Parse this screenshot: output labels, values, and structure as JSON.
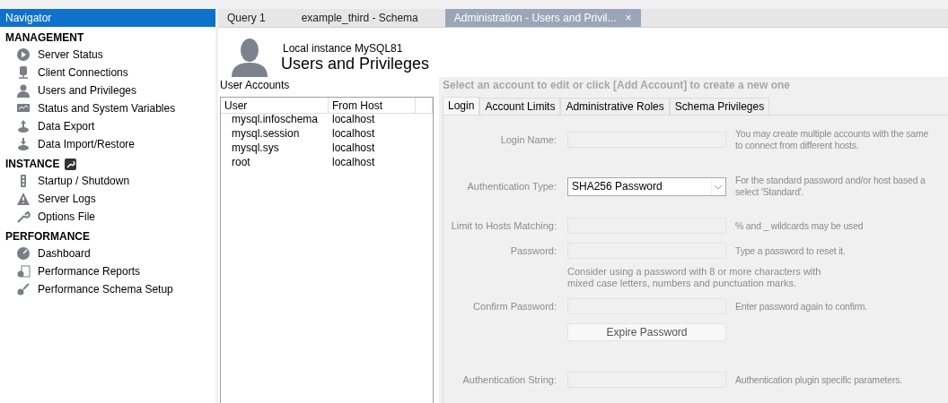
{
  "navigator": {
    "title": "Navigator",
    "sections": [
      {
        "heading": "MANAGEMENT",
        "items": [
          {
            "label": "Server Status"
          },
          {
            "label": "Client Connections"
          },
          {
            "label": "Users and Privileges"
          },
          {
            "label": "Status and System Variables"
          },
          {
            "label": "Data Export"
          },
          {
            "label": "Data Import/Restore"
          }
        ]
      },
      {
        "heading": "INSTANCE",
        "items": [
          {
            "label": "Startup / Shutdown"
          },
          {
            "label": "Server Logs"
          },
          {
            "label": "Options File"
          }
        ]
      },
      {
        "heading": "PERFORMANCE",
        "items": [
          {
            "label": "Dashboard"
          },
          {
            "label": "Performance Reports"
          },
          {
            "label": "Performance Schema Setup"
          }
        ]
      }
    ]
  },
  "tabs": [
    {
      "label": "Query 1",
      "selected": false
    },
    {
      "label": "example_third - Schema",
      "selected": false
    },
    {
      "label": "Administration - Users and Privil...",
      "selected": true,
      "close": "×"
    }
  ],
  "header": {
    "instance": "Local instance MySQL81",
    "title": "Users and Privileges"
  },
  "accounts": {
    "title": "User Accounts",
    "columns": [
      "User",
      "From Host"
    ],
    "rows": [
      {
        "user": "mysql.infoschema",
        "host": "localhost"
      },
      {
        "user": "mysql.session",
        "host": "localhost"
      },
      {
        "user": "mysql.sys",
        "host": "localhost"
      },
      {
        "user": "root",
        "host": "localhost"
      }
    ]
  },
  "details": {
    "prompt": "Select an account to edit or click [Add Account] to create a new one",
    "tabs": [
      {
        "label": "Login",
        "selected": true
      },
      {
        "label": "Account Limits",
        "selected": false
      },
      {
        "label": "Administrative Roles",
        "selected": false
      },
      {
        "label": "Schema Privileges",
        "selected": false
      }
    ],
    "rows": [
      {
        "kind": "input",
        "label": "Login Name:",
        "hint": "You may create multiple accounts with the same\nto connect from different hosts."
      },
      {
        "kind": "select",
        "label": "Authentication Type:",
        "value": "SHA256 Password",
        "hint": "For the standard password and/or host based a\nselect 'Standard'."
      },
      {
        "kind": "input",
        "label": "Limit to Hosts Matching:",
        "hint": "% and _ wildcards may be used"
      },
      {
        "kind": "input",
        "label": "Password:",
        "hint": "Type a password to reset it."
      },
      {
        "kind": "note",
        "text": "Consider using a password with 8 or more characters with\nmixed case letters, numbers and punctuation marks."
      },
      {
        "kind": "input",
        "label": "Confirm Password:",
        "hint": "Enter password again to confirm."
      },
      {
        "kind": "button",
        "text": "Expire Password"
      },
      {
        "kind": "input",
        "label": "Authentication String:",
        "hint": "Authentication plugin specific parameters."
      }
    ]
  }
}
